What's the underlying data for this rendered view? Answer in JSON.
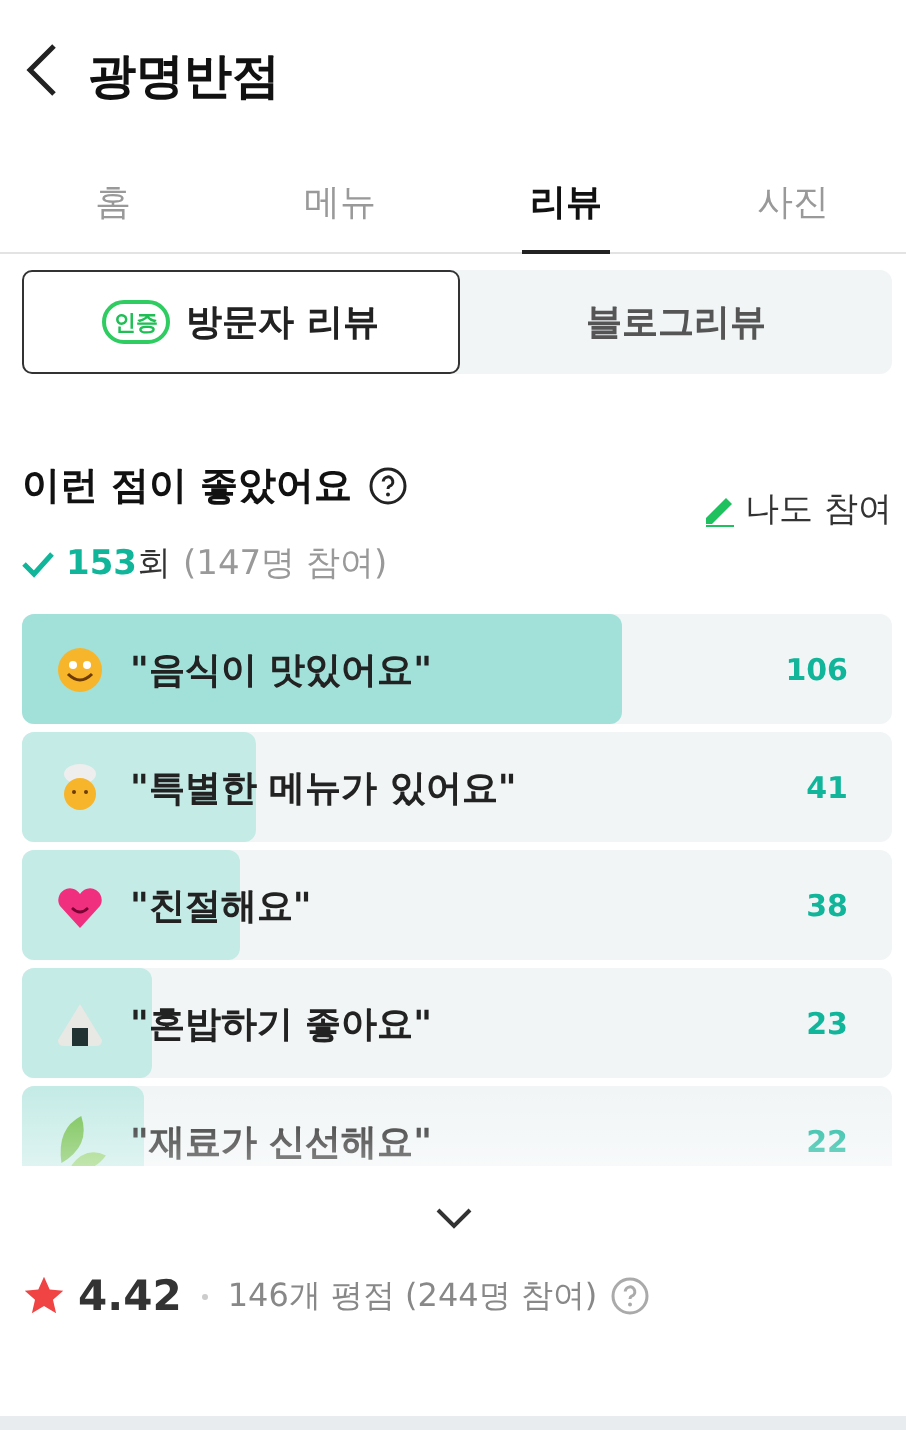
{
  "header": {
    "title": "광명반점"
  },
  "tabs": [
    {
      "label": "홈",
      "selected": false
    },
    {
      "label": "메뉴",
      "selected": false
    },
    {
      "label": "리뷰",
      "selected": true
    },
    {
      "label": "사진",
      "selected": false
    }
  ],
  "segments": [
    {
      "label": "방문자 리뷰",
      "badge": "인증",
      "selected": true
    },
    {
      "label": "블로그리뷰",
      "selected": false
    }
  ],
  "section": {
    "title": "이런 점이 좋았어요",
    "join": "나도 참여",
    "count": "153",
    "count_unit": "회",
    "participants": "(147명 참여)"
  },
  "keywords": [
    {
      "kind": "smile",
      "label": "\"음식이 맛있어요\"",
      "count": "106",
      "level": 0.69
    },
    {
      "kind": "chef",
      "label": "\"특별한 메뉴가 있어요\"",
      "count": "41",
      "level": 0.27
    },
    {
      "kind": "heart",
      "label": "\"친절해요\"",
      "count": "38",
      "level": 0.25
    },
    {
      "kind": "riceball",
      "label": "\"혼밥하기 좋아요\"",
      "count": "23",
      "level": 0.15
    },
    {
      "kind": "leaf",
      "label": "\"재료가 신선해요\"",
      "count": "22",
      "level": 0.14
    }
  ],
  "rating": {
    "score": "4.42",
    "summary": "146개 평점 (244명 참여)"
  }
}
